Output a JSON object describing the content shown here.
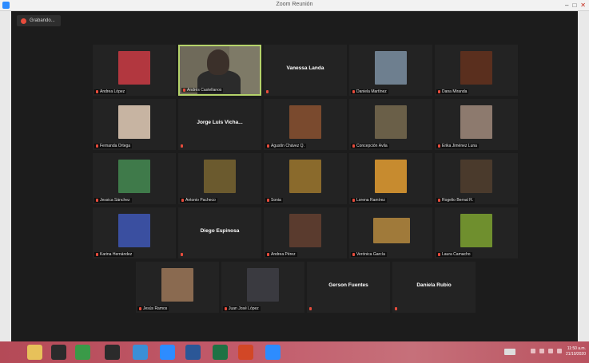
{
  "window": {
    "title": "Zoom Reunión"
  },
  "recording": {
    "label": "Grabando..."
  },
  "participants": [
    {
      "name": "Andrea López",
      "type": "avatar",
      "color": "#b2373f"
    },
    {
      "name": "Andrés Castellanos",
      "type": "video",
      "active": true
    },
    {
      "name": "Vanessa Landa",
      "type": "name"
    },
    {
      "name": "Daniela Martínez",
      "type": "avatar",
      "color": "#6e7f8f"
    },
    {
      "name": "Dana Miranda",
      "type": "avatar",
      "color": "#5a2f1e"
    },
    {
      "name": "Fernanda Ortega",
      "type": "avatar",
      "color": "#c7b4a2"
    },
    {
      "name": "Jorge Luis Vicha...",
      "type": "name"
    },
    {
      "name": "Agustín Chávez Q.",
      "type": "avatar",
      "color": "#7a4a2e"
    },
    {
      "name": "Concepción Ávila",
      "type": "avatar",
      "color": "#6a5f48"
    },
    {
      "name": "Erika Jiménez Luna",
      "type": "avatar",
      "color": "#8d7a6e"
    },
    {
      "name": "Jessica Sánchez",
      "type": "avatar",
      "color": "#3f7a4a"
    },
    {
      "name": "Antonio Pacheco",
      "type": "avatar",
      "color": "#6b5a2e"
    },
    {
      "name": "Sonia",
      "type": "avatar",
      "color": "#8a6a2c"
    },
    {
      "name": "Lorena Ramírez",
      "type": "avatar",
      "color": "#c78b2f"
    },
    {
      "name": "Rogelio Bernal R.",
      "type": "avatar",
      "color": "#4a3a2c"
    },
    {
      "name": "Karina Hernández",
      "type": "avatar",
      "color": "#3a4fa0"
    },
    {
      "name": "Diego Espinosa",
      "type": "name"
    },
    {
      "name": "Andrea Pérez",
      "type": "avatar",
      "color": "#5a3b2e"
    },
    {
      "name": "Verónica García",
      "type": "avatar",
      "color": "#a07a3a",
      "wide": true
    },
    {
      "name": "Laura Camacho",
      "type": "avatar",
      "color": "#6f8f2e"
    },
    {
      "name": "Jesús Ramos",
      "type": "avatar",
      "color": "#8a6a50"
    },
    {
      "name": "Juan José López",
      "type": "avatar",
      "color": "#3a3a40"
    },
    {
      "name": "Gerson Fuentes",
      "type": "name"
    },
    {
      "name": "Daniela Rubio",
      "type": "name"
    }
  ],
  "taskbar": {
    "apps": [
      {
        "name": "folder-icon",
        "color": "#e7c15a"
      },
      {
        "name": "media-icon",
        "color": "#2b2b2b"
      },
      {
        "name": "chrome-icon",
        "color": "#3a9a48"
      },
      {
        "name": "app-icon",
        "color": "#2b2b2b"
      },
      {
        "name": "ie-icon",
        "color": "#3b8fd6"
      },
      {
        "name": "zoom-icon",
        "color": "#2d8cff"
      },
      {
        "name": "word-icon",
        "color": "#2b5797"
      },
      {
        "name": "excel-icon",
        "color": "#1f7244"
      },
      {
        "name": "powerpoint-icon",
        "color": "#d24726"
      },
      {
        "name": "zoom-video-icon",
        "color": "#2d8cff"
      }
    ],
    "time": "11:50 a.m.",
    "date": "21/10/2020"
  }
}
